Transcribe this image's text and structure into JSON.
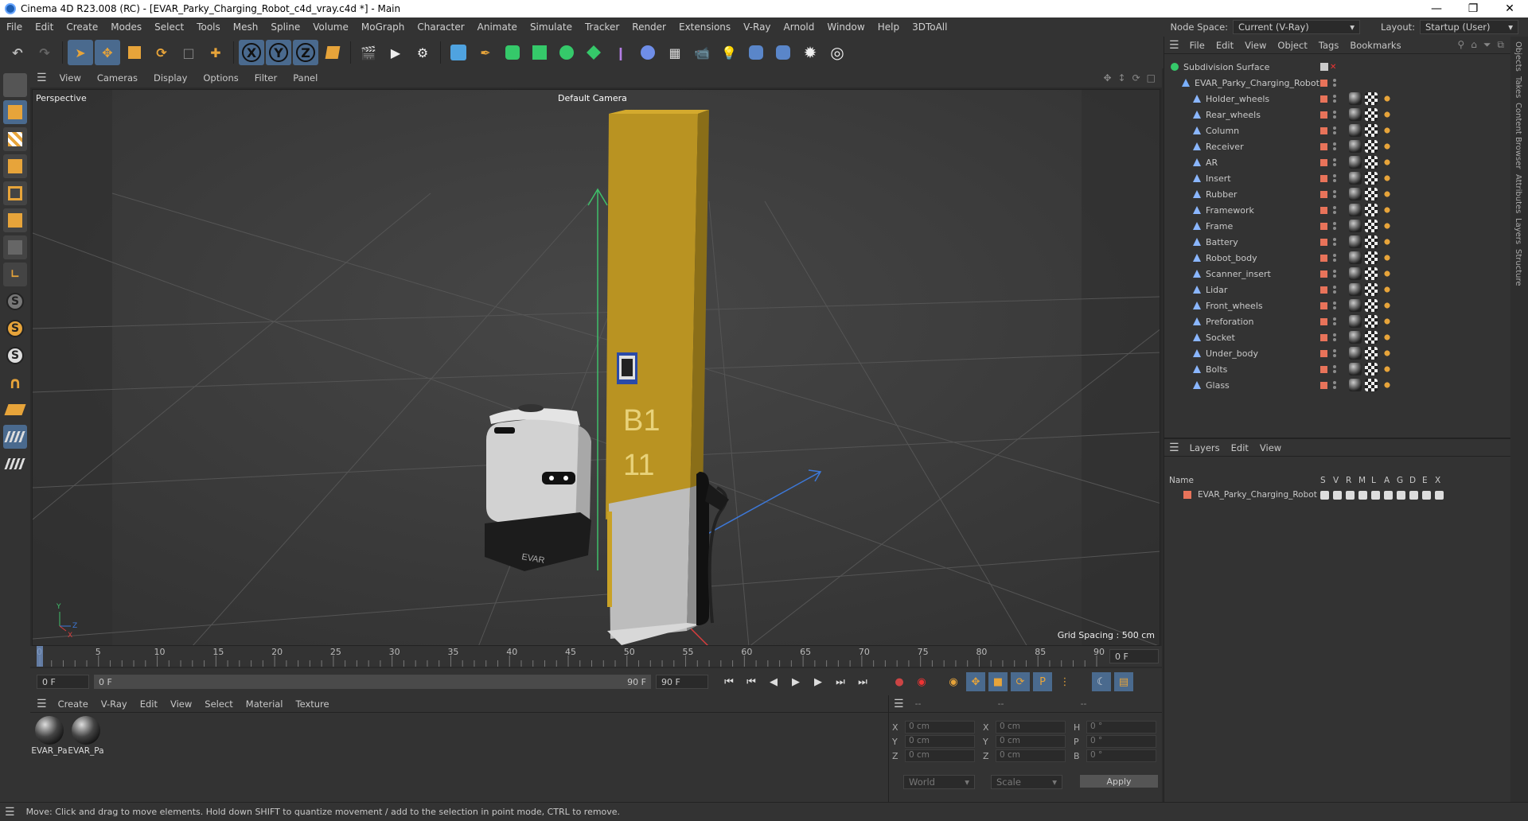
{
  "window": {
    "title": "Cinema 4D R23.008 (RC) - [EVAR_Parky_Charging_Robot_c4d_vray.c4d *] - Main"
  },
  "menu": [
    "File",
    "Edit",
    "Create",
    "Modes",
    "Select",
    "Tools",
    "Mesh",
    "Spline",
    "Volume",
    "MoGraph",
    "Character",
    "Animate",
    "Simulate",
    "Tracker",
    "Render",
    "Extensions",
    "V-Ray",
    "Arnold",
    "Window",
    "Help",
    "3DToAll"
  ],
  "node_space": {
    "label": "Node Space:",
    "value": "Current (V-Ray)"
  },
  "layout": {
    "label": "Layout:",
    "value": "Startup (User)"
  },
  "toolbar": {
    "axis_x": "X",
    "axis_y": "Y",
    "axis_z": "Z"
  },
  "viewport_menu": [
    "View",
    "Cameras",
    "Display",
    "Options",
    "Filter",
    "Panel"
  ],
  "viewport": {
    "name": "Perspective",
    "camera": "Default Camera",
    "grid_spacing": "Grid Spacing : 500 cm",
    "sign_line1": "B1",
    "sign_line2": "11",
    "robot_brand": "EVAR"
  },
  "timeline": {
    "ticks": [
      "0",
      "5",
      "10",
      "15",
      "20",
      "25",
      "30",
      "35",
      "40",
      "45",
      "50",
      "55",
      "60",
      "65",
      "70",
      "75",
      "80",
      "85",
      "90"
    ],
    "current_frame": "0 F"
  },
  "transport": {
    "start": "0 F",
    "slider_start": "0 F",
    "slider_end": "90 F",
    "end": "90 F"
  },
  "material_menu": [
    "Create",
    "V-Ray",
    "Edit",
    "View",
    "Select",
    "Material",
    "Texture"
  ],
  "materials": [
    {
      "label": "EVAR_Pa"
    },
    {
      "label": "EVAR_Pa"
    }
  ],
  "coords": {
    "header": [
      "--",
      "--",
      "--"
    ],
    "rows": [
      {
        "a": "X",
        "av": "0 cm",
        "b": "X",
        "bv": "0 cm",
        "c": "H",
        "cv": "0 °"
      },
      {
        "a": "Y",
        "av": "0 cm",
        "b": "Y",
        "bv": "0 cm",
        "c": "P",
        "cv": "0 °"
      },
      {
        "a": "Z",
        "av": "0 cm",
        "b": "Z",
        "bv": "0 cm",
        "c": "B",
        "cv": "0 °"
      }
    ],
    "space": "World",
    "mode": "Scale",
    "apply": "Apply"
  },
  "status": "Move: Click and drag to move elements. Hold down SHIFT to quantize movement / add to the selection in point mode, CTRL to remove.",
  "objects_menu": [
    "File",
    "Edit",
    "View",
    "Object",
    "Tags",
    "Bookmarks"
  ],
  "objects": {
    "root": "Subdivision Surface",
    "group": "EVAR_Parky_Charging_Robot",
    "children": [
      "Holder_wheels",
      "Rear_wheels",
      "Column",
      "Receiver",
      "AR",
      "Insert",
      "Rubber",
      "Framework",
      "Frame",
      "Battery",
      "Robot_body",
      "Scanner_insert",
      "Lidar",
      "Front_wheels",
      "Preforation",
      "Socket",
      "Under_body",
      "Bolts",
      "Glass"
    ]
  },
  "layers_menu": [
    "Layers",
    "Edit",
    "View"
  ],
  "layers_header": {
    "name": "Name",
    "cols": [
      "S",
      "V",
      "R",
      "M",
      "L",
      "A",
      "G",
      "D",
      "E",
      "X"
    ]
  },
  "layers": [
    {
      "name": "EVAR_Parky_Charging_Robot",
      "color": "#e8735a"
    }
  ],
  "side_tabs": [
    "Objects",
    "Takes",
    "Content Browser",
    "Attributes",
    "Layers",
    "Structure"
  ],
  "colors": {
    "accent": "#4a6a8e",
    "pole": "#c9a227",
    "layer": "#e8735a"
  }
}
